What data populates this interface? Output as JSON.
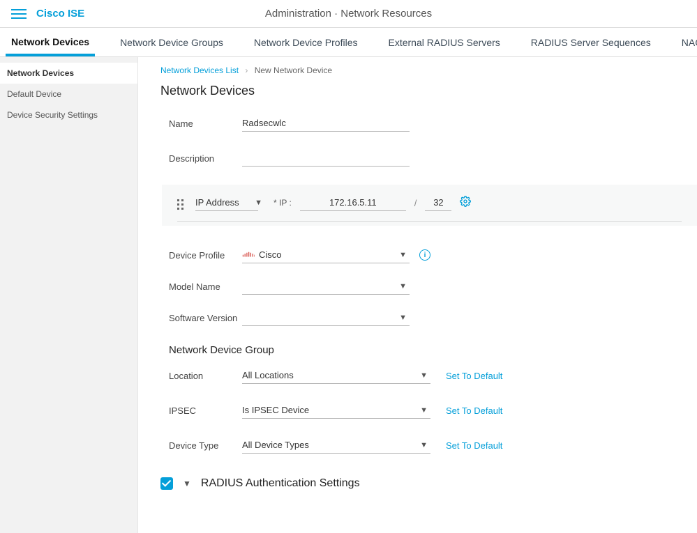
{
  "brand": "Cisco ISE",
  "top_title": "Administration · Network Resources",
  "tabs": [
    {
      "label": "Network Devices"
    },
    {
      "label": "Network Device Groups"
    },
    {
      "label": "Network Device Profiles"
    },
    {
      "label": "External RADIUS Servers"
    },
    {
      "label": "RADIUS Server Sequences"
    },
    {
      "label": "NAC Manage"
    }
  ],
  "sidebar": {
    "items": [
      {
        "label": "Network Devices"
      },
      {
        "label": "Default Device"
      },
      {
        "label": "Device Security Settings"
      }
    ]
  },
  "breadcrumb": {
    "parent": "Network Devices List",
    "current": "New Network Device"
  },
  "page_heading": "Network Devices",
  "form": {
    "name_label": "Name",
    "name_value": "Radsecwlc",
    "description_label": "Description",
    "description_value": "",
    "ip_type": "IP Address",
    "ip_field_label": "* IP :",
    "ip_value": "172.16.5.11",
    "ip_mask": "32",
    "device_profile_label": "Device Profile",
    "device_profile_value": "Cisco",
    "model_name_label": "Model Name",
    "model_name_value": "",
    "software_version_label": "Software Version",
    "software_version_value": ""
  },
  "group": {
    "heading": "Network Device Group",
    "location_label": "Location",
    "location_value": "All Locations",
    "ipsec_label": "IPSEC",
    "ipsec_value": "Is IPSEC Device",
    "device_type_label": "Device Type",
    "device_type_value": "All Device Types",
    "set_default": "Set To Default"
  },
  "radius_section_title": "RADIUS Authentication Settings"
}
